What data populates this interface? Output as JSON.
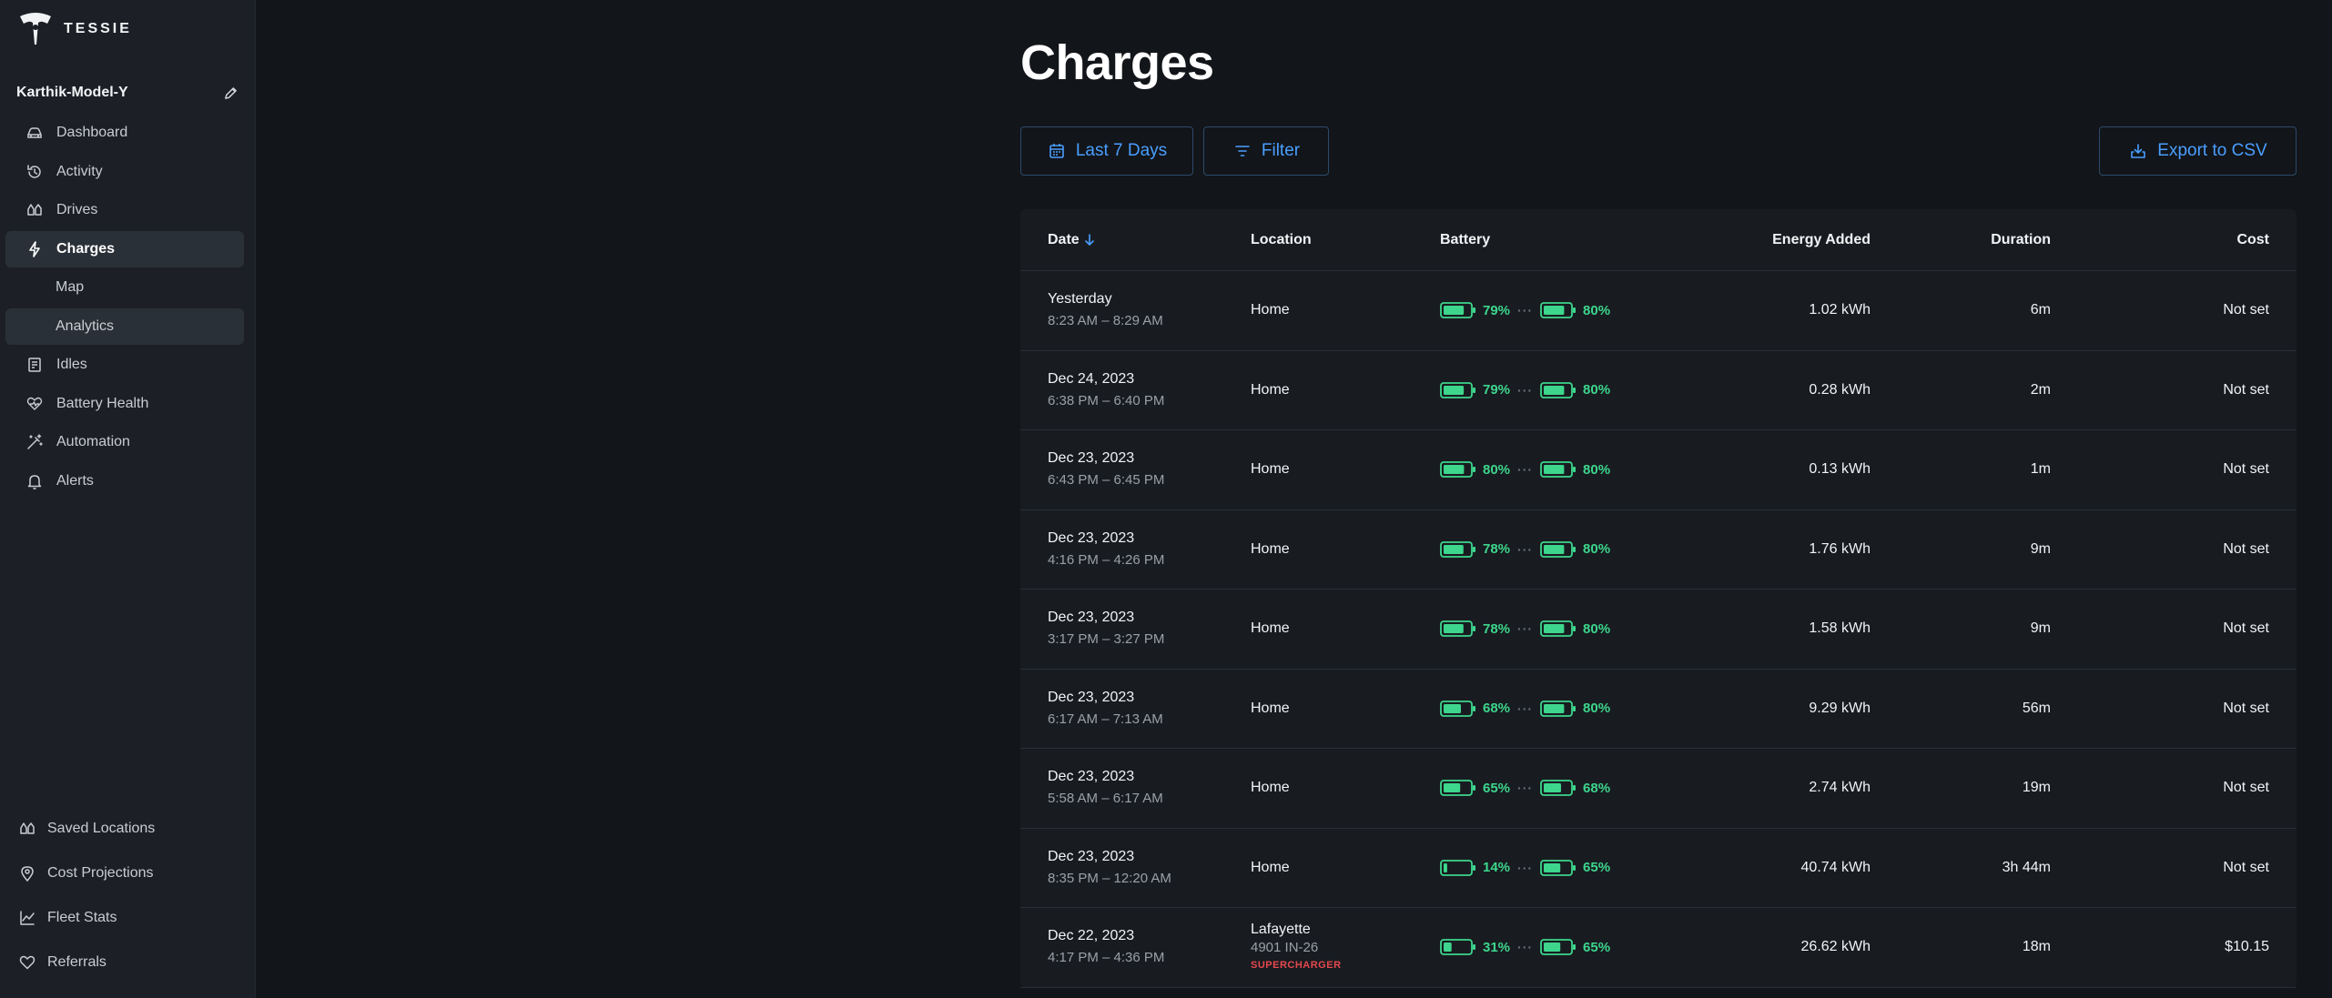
{
  "app": {
    "logo_text": "TESSIE",
    "vehicle_name": "Karthik-Model-Y"
  },
  "sidebar": {
    "items": [
      {
        "label": "Dashboard",
        "icon": "car-icon"
      },
      {
        "label": "Activity",
        "icon": "history-icon"
      },
      {
        "label": "Drives",
        "icon": "drives-icon"
      },
      {
        "label": "Charges",
        "icon": "bolt-icon",
        "active": true
      },
      {
        "label": "Map"
      },
      {
        "label": "Analytics"
      },
      {
        "label": "Idles",
        "icon": "idle-icon"
      },
      {
        "label": "Battery Health",
        "icon": "heart-pulse-icon"
      },
      {
        "label": "Automation",
        "icon": "wand-icon"
      },
      {
        "label": "Alerts",
        "icon": "bell-icon"
      }
    ],
    "bottom_items": [
      {
        "label": "Saved Locations",
        "icon": "map-icon"
      },
      {
        "label": "Cost Projections",
        "icon": "pin-icon"
      },
      {
        "label": "Fleet Stats",
        "icon": "chart-icon"
      },
      {
        "label": "Referrals",
        "icon": "heart-icon"
      }
    ]
  },
  "main": {
    "title": "Charges",
    "date_button": "Last 7 Days",
    "filter_button": "Filter",
    "export_button": "Export to CSV"
  },
  "table": {
    "headers": {
      "date": "Date",
      "location": "Location",
      "battery": "Battery",
      "energy": "Energy Added",
      "duration": "Duration",
      "cost": "Cost"
    },
    "rows": [
      {
        "date": "Yesterday",
        "time": "8:23 AM – 8:29 AM",
        "location": "Home",
        "sub": "",
        "tag": "",
        "start": "79%",
        "end": "80%",
        "energy": "1.02 kWh",
        "duration": "6m",
        "cost": "Not set"
      },
      {
        "date": "Dec 24, 2023",
        "time": "6:38 PM – 6:40 PM",
        "location": "Home",
        "sub": "",
        "tag": "",
        "start": "79%",
        "end": "80%",
        "energy": "0.28 kWh",
        "duration": "2m",
        "cost": "Not set"
      },
      {
        "date": "Dec 23, 2023",
        "time": "6:43 PM – 6:45 PM",
        "location": "Home",
        "sub": "",
        "tag": "",
        "start": "80%",
        "end": "80%",
        "energy": "0.13 kWh",
        "duration": "1m",
        "cost": "Not set"
      },
      {
        "date": "Dec 23, 2023",
        "time": "4:16 PM – 4:26 PM",
        "location": "Home",
        "sub": "",
        "tag": "",
        "start": "78%",
        "end": "80%",
        "energy": "1.76 kWh",
        "duration": "9m",
        "cost": "Not set"
      },
      {
        "date": "Dec 23, 2023",
        "time": "3:17 PM – 3:27 PM",
        "location": "Home",
        "sub": "",
        "tag": "",
        "start": "78%",
        "end": "80%",
        "energy": "1.58 kWh",
        "duration": "9m",
        "cost": "Not set"
      },
      {
        "date": "Dec 23, 2023",
        "time": "6:17 AM – 7:13 AM",
        "location": "Home",
        "sub": "",
        "tag": "",
        "start": "68%",
        "end": "80%",
        "energy": "9.29 kWh",
        "duration": "56m",
        "cost": "Not set"
      },
      {
        "date": "Dec 23, 2023",
        "time": "5:58 AM – 6:17 AM",
        "location": "Home",
        "sub": "",
        "tag": "",
        "start": "65%",
        "end": "68%",
        "energy": "2.74 kWh",
        "duration": "19m",
        "cost": "Not set"
      },
      {
        "date": "Dec 23, 2023",
        "time": "8:35 PM – 12:20 AM",
        "location": "Home",
        "sub": "",
        "tag": "",
        "start": "14%",
        "end": "65%",
        "energy": "40.74 kWh",
        "duration": "3h 44m",
        "cost": "Not set"
      },
      {
        "date": "Dec 22, 2023",
        "time": "4:17 PM – 4:36 PM",
        "location": "Lafayette",
        "sub": "4901 IN-26",
        "tag": "SUPERCHARGER",
        "start": "31%",
        "end": "65%",
        "energy": "26.62 kWh",
        "duration": "18m",
        "cost": "$10.15"
      }
    ]
  },
  "colors": {
    "accent": "#4a9eff",
    "battery": "#3dd68c",
    "supercharger": "#e5484d"
  }
}
